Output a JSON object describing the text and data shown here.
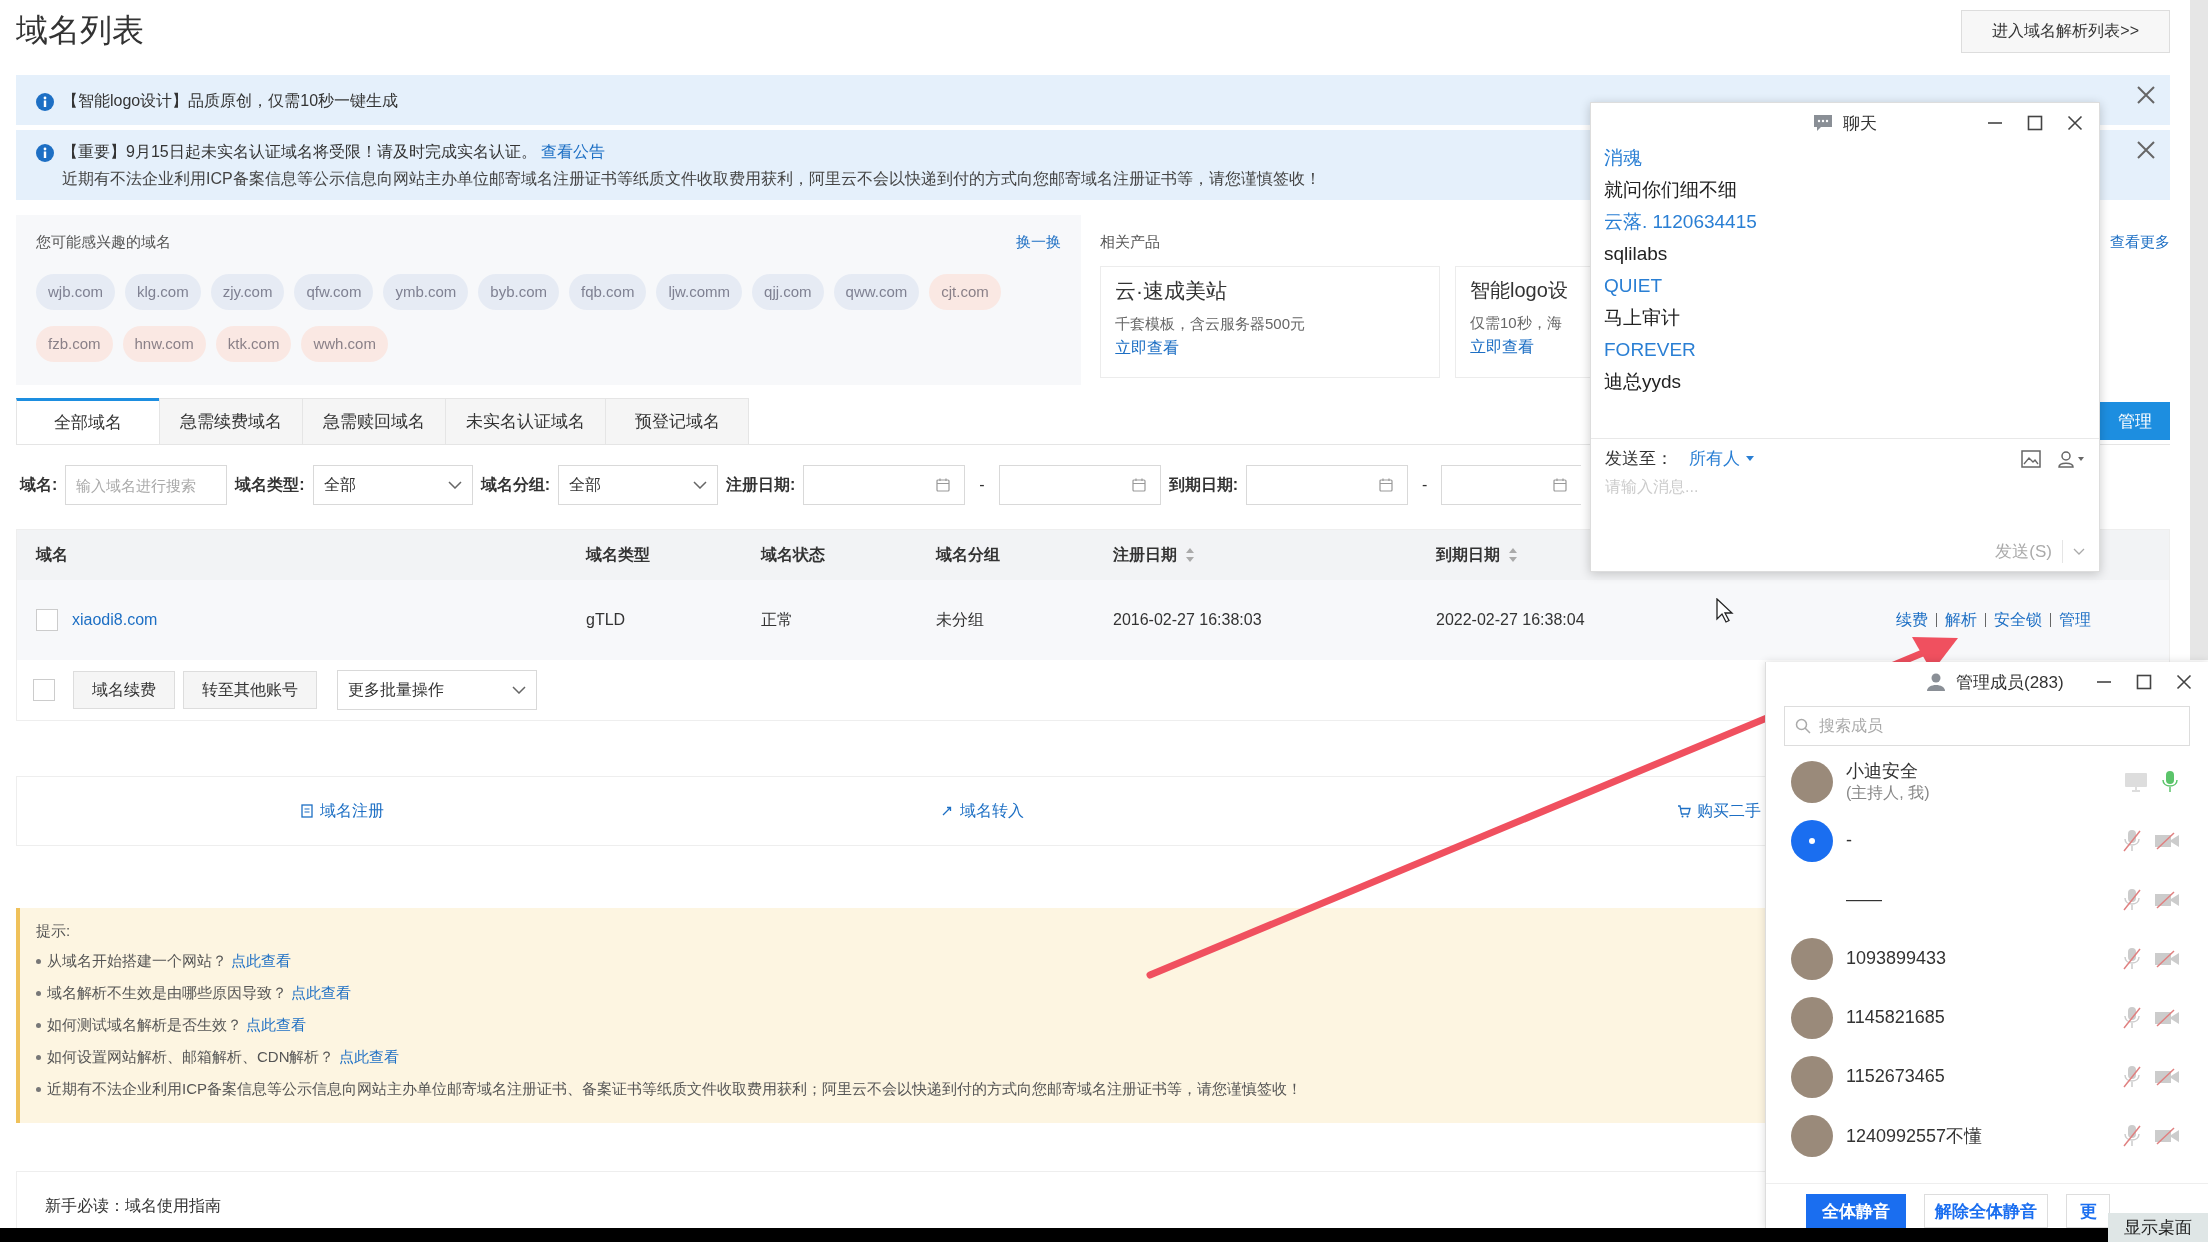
{
  "page": {
    "title": "域名列表",
    "dns_button": "进入域名解析列表>>"
  },
  "notices": [
    {
      "text": "【智能logo设计】品质原创，仅需10秒一键生成"
    },
    {
      "text": "【重要】9月15日起未实名认证域名将受限！请及时完成实名认证。",
      "link": "查看公告",
      "detail": "近期有不法企业利用ICP备案信息等公示信息向网站主办单位邮寄域名注册证书等纸质文件收取费用获利，阿里云不会以快递到付的方式向您邮寄域名注册证书等，请您谨慎签收！"
    }
  ],
  "suggestions": {
    "title": "您可能感兴趣的域名",
    "refresh": "换一换",
    "tags": [
      {
        "label": "wjb.com",
        "color": "#e6ebf4"
      },
      {
        "label": "klg.com",
        "color": "#e6ebf4"
      },
      {
        "label": "zjy.com",
        "color": "#e6ebf4"
      },
      {
        "label": "qfw.com",
        "color": "#e6ebf4"
      },
      {
        "label": "ymb.com",
        "color": "#e6ebf4"
      },
      {
        "label": "byb.com",
        "color": "#e6ebf4"
      },
      {
        "label": "fqb.com",
        "color": "#e6ebf4"
      },
      {
        "label": "ljw.comm",
        "color": "#e6ebf4"
      },
      {
        "label": "qjj.com",
        "color": "#e6ebf4"
      },
      {
        "label": "qww.com",
        "color": "#e6ebf4"
      },
      {
        "label": "cjt.com",
        "color": "#fae8e3"
      },
      {
        "label": "fzb.com",
        "color": "#fae8e3"
      },
      {
        "label": "hnw.com",
        "color": "#fae8e3"
      },
      {
        "label": "ktk.com",
        "color": "#fae8e3"
      },
      {
        "label": "wwh.com",
        "color": "#fae8e3"
      }
    ]
  },
  "related": {
    "title": "相关产品",
    "more": "查看更多",
    "cards": [
      {
        "title": "云·速成美站",
        "desc": "千套模板，含云服务器500元",
        "link": "立即查看"
      },
      {
        "title": "智能logo设",
        "desc": "仅需10秒，海",
        "link": "立即查看"
      }
    ]
  },
  "tabs": [
    {
      "label": "全部域名",
      "selected": true
    },
    {
      "label": "急需续费域名",
      "selected": false
    },
    {
      "label": "急需赎回域名",
      "selected": false
    },
    {
      "label": "未实名认证域名",
      "selected": false
    },
    {
      "label": "预登记域名",
      "selected": false
    }
  ],
  "manage_button": "管理",
  "filters": [
    {
      "kind": "text",
      "label": "域名:",
      "placeholder": "输入域名进行搜索"
    },
    {
      "kind": "select",
      "label": "域名类型:",
      "value": "全部"
    },
    {
      "kind": "select",
      "label": "域名分组:",
      "value": "全部"
    },
    {
      "kind": "range",
      "label": "注册日期:",
      "separator": "-"
    },
    {
      "kind": "range",
      "label": "到期日期:",
      "separator": "-"
    }
  ],
  "table": {
    "columns": [
      {
        "label": "域名",
        "sortable": false
      },
      {
        "label": "域名类型",
        "sortable": false
      },
      {
        "label": "域名状态",
        "sortable": false
      },
      {
        "label": "域名分组",
        "sortable": false
      },
      {
        "label": "注册日期",
        "sortable": true
      },
      {
        "label": "到期日期",
        "sortable": true
      }
    ],
    "rows": [
      {
        "checked": false,
        "cells": [
          "xiaodi8.com",
          "gTLD",
          "正常",
          "未分组",
          "2016-02-27 16:38:03",
          "2022-02-27 16:38:04"
        ],
        "actions": [
          "续费",
          "解析",
          "安全锁",
          "管理"
        ]
      }
    ]
  },
  "batch": {
    "checked": false,
    "buttons": [
      "域名续费",
      "转至其他账号"
    ],
    "select": "更多批量操作"
  },
  "quick_links": [
    {
      "kind": "register",
      "label": "域名注册"
    },
    {
      "kind": "transfer",
      "label": "域名转入"
    },
    {
      "kind": "cart",
      "label": "购买二手"
    }
  ],
  "tips": {
    "title": "提示:",
    "items": [
      {
        "text": "从域名开始搭建一个网站？",
        "link": "点此查看"
      },
      {
        "text": "域名解析不生效是由哪些原因导致？",
        "link": "点此查看"
      },
      {
        "text": "如何测试域名解析是否生效？",
        "link": "点此查看"
      },
      {
        "text": "如何设置网站解析、邮箱解析、CDN解析？",
        "link": "点此查看"
      },
      {
        "text": "近期有不法企业利用ICP备案信息等公示信息向网站主办单位邮寄域名注册证书、备案证书等纸质文件收取费用获利；阿里云不会以快递到付的方式向您邮寄域名注册证书等，请您谨慎签收！"
      }
    ]
  },
  "guide": "新手必读：域名使用指南",
  "chat": {
    "title": "聊天",
    "messages": [
      {
        "kind": "sender",
        "text": "消魂"
      },
      {
        "kind": "message",
        "text": "就问你们细不细"
      },
      {
        "kind": "sender",
        "text": "云落. 1120634415"
      },
      {
        "kind": "message",
        "text": "sqlilabs"
      },
      {
        "kind": "sender",
        "text": "QUIET"
      },
      {
        "kind": "message",
        "text": "马上审计"
      },
      {
        "kind": "sender",
        "text": "FOREVER"
      },
      {
        "kind": "message",
        "text": "迪总yyds"
      }
    ],
    "send_to_label": "发送至：",
    "recipient": "所有人",
    "placeholder": "请输入消息...",
    "send_button": "发送(S)"
  },
  "members": {
    "title": "管理成员(283)",
    "search_placeholder": "搜索成员",
    "list": [
      {
        "name": "小迪安全",
        "role": "(主持人, 我)",
        "kind": "photo",
        "muted": false
      },
      {
        "name": "-",
        "kind": "dot",
        "muted": true
      },
      {
        "name": "——",
        "kind": "none",
        "muted": true
      },
      {
        "name": "1093899433",
        "kind": "photo",
        "muted": true
      },
      {
        "name": "1145821685",
        "kind": "photo",
        "muted": true
      },
      {
        "name": "1152673465",
        "kind": "photo",
        "muted": true
      },
      {
        "name": "1240992557不懂",
        "kind": "photo",
        "muted": true
      }
    ],
    "buttons": [
      {
        "label": "全体静音",
        "primary": true
      },
      {
        "label": "解除全体静音",
        "primary": false
      },
      {
        "label": "更",
        "primary": false
      }
    ]
  },
  "taskbar": {
    "show_desktop": "显示桌面"
  }
}
